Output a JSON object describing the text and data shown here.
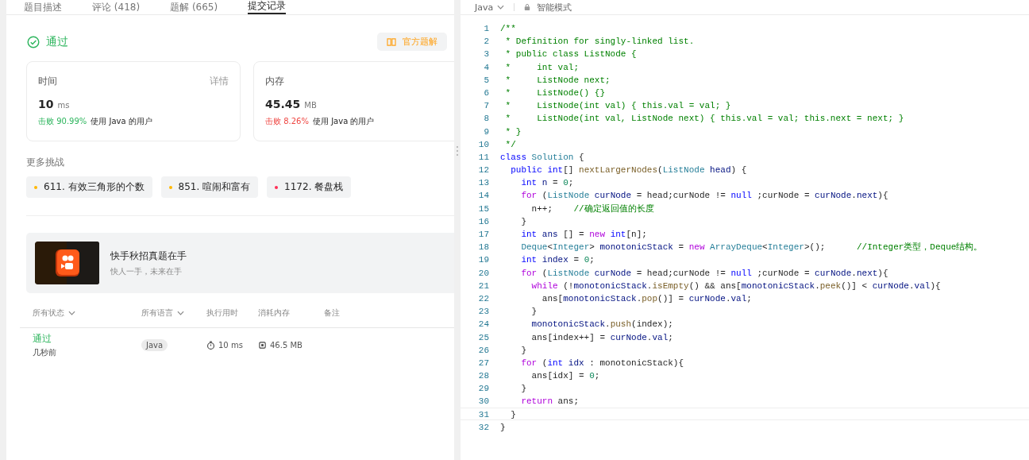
{
  "tabs": [
    {
      "label": "题目描述",
      "selected": false
    },
    {
      "label": "评论 (418)",
      "selected": false
    },
    {
      "label": "题解 (665)",
      "selected": false
    },
    {
      "label": "提交记录",
      "selected": true
    }
  ],
  "result": {
    "status": "通过",
    "solution_button": "官方题解"
  },
  "cards": [
    {
      "title": "时间",
      "detail": "详情",
      "value": "10",
      "unit": "ms",
      "beat": "击败 90.99%",
      "kind": "good",
      "note": "使用 Java 的用户"
    },
    {
      "title": "内存",
      "value": "45.45",
      "unit": "MB",
      "beat": "击败 8.26%",
      "kind": "bad",
      "note": "使用 Java 的用户"
    }
  ],
  "more_challenges": {
    "title": "更多挑战",
    "items": [
      {
        "label": "611. 有效三角形的个数",
        "color": "#ffb800"
      },
      {
        "label": "851. 喧闹和富有",
        "color": "#ffb800"
      },
      {
        "label": "1172. 餐盘栈",
        "color": "#ff2d55"
      }
    ]
  },
  "banner": {
    "title": "快手秋招真题在手",
    "subtitle": "快人一手，未来在手"
  },
  "table": {
    "columns": [
      {
        "label": "所有状态",
        "dropdown": true
      },
      {
        "label": "所有语言",
        "dropdown": true
      },
      {
        "label": "执行用时",
        "dropdown": false
      },
      {
        "label": "消耗内存",
        "dropdown": false
      },
      {
        "label": "备注",
        "dropdown": false
      }
    ],
    "rows": [
      {
        "status": "通过",
        "time_ago": "几秒前",
        "language": "Java",
        "runtime": "10 ms",
        "memory": "46.5 MB"
      }
    ]
  },
  "editor": {
    "language": "Java",
    "mode": "智能模式",
    "lines": [
      {
        "number": "1",
        "active": false,
        "tokens": [
          {
            "kind": "comment",
            "text": "/**"
          }
        ]
      },
      {
        "number": "2",
        "active": false,
        "tokens": [
          {
            "kind": "comment",
            "text": " * Definition for singly-linked list."
          }
        ]
      },
      {
        "number": "3",
        "active": false,
        "tokens": [
          {
            "kind": "comment",
            "text": " * public class ListNode {"
          }
        ]
      },
      {
        "number": "4",
        "active": false,
        "tokens": [
          {
            "kind": "comment",
            "text": " *     int val;"
          }
        ]
      },
      {
        "number": "5",
        "active": false,
        "tokens": [
          {
            "kind": "comment",
            "text": " *     ListNode next;"
          }
        ]
      },
      {
        "number": "6",
        "active": false,
        "tokens": [
          {
            "kind": "comment",
            "text": " *     ListNode() {}"
          }
        ]
      },
      {
        "number": "7",
        "active": false,
        "tokens": [
          {
            "kind": "comment",
            "text": " *     ListNode(int val) { this.val = val; }"
          }
        ]
      },
      {
        "number": "8",
        "active": false,
        "tokens": [
          {
            "kind": "comment",
            "text": " *     ListNode(int val, ListNode next) { this.val = val; this.next = next; }"
          }
        ]
      },
      {
        "number": "9",
        "active": false,
        "tokens": [
          {
            "kind": "comment",
            "text": " * }"
          }
        ]
      },
      {
        "number": "10",
        "active": false,
        "tokens": [
          {
            "kind": "comment",
            "text": " */"
          }
        ]
      },
      {
        "number": "11",
        "active": false,
        "tokens": [
          {
            "kind": "builtin",
            "text": "class "
          },
          {
            "kind": "type",
            "text": "Solution"
          },
          {
            "kind": "plain",
            "text": " {"
          }
        ]
      },
      {
        "number": "12",
        "active": false,
        "tokens": [
          {
            "kind": "builtin",
            "text": "  public int"
          },
          {
            "kind": "plain",
            "text": "[] "
          },
          {
            "kind": "function",
            "text": "nextLargerNodes"
          },
          {
            "kind": "plain",
            "text": "("
          },
          {
            "kind": "type",
            "text": "ListNode "
          },
          {
            "kind": "variable",
            "text": "head"
          },
          {
            "kind": "plain",
            "text": ") {"
          }
        ]
      },
      {
        "number": "13",
        "active": false,
        "tokens": [
          {
            "kind": "builtin",
            "text": "    int "
          },
          {
            "kind": "variable",
            "text": "n"
          },
          {
            "kind": "plain",
            "text": " = "
          },
          {
            "kind": "number",
            "text": "0"
          },
          {
            "kind": "plain",
            "text": ";"
          }
        ]
      },
      {
        "number": "14",
        "active": false,
        "tokens": [
          {
            "kind": "keyword",
            "text": "    for"
          },
          {
            "kind": "plain",
            "text": " ("
          },
          {
            "kind": "type",
            "text": "ListNode "
          },
          {
            "kind": "variable",
            "text": "curNode"
          },
          {
            "kind": "plain",
            "text": " = head;curNode != "
          },
          {
            "kind": "builtin",
            "text": "null"
          },
          {
            "kind": "plain",
            "text": " ;curNode = "
          },
          {
            "kind": "variable",
            "text": "curNode"
          },
          {
            "kind": "plain",
            "text": "."
          },
          {
            "kind": "variable",
            "text": "next"
          },
          {
            "kind": "plain",
            "text": "){"
          }
        ]
      },
      {
        "number": "15",
        "active": false,
        "tokens": [
          {
            "kind": "plain",
            "text": "      n++;    "
          },
          {
            "kind": "comment",
            "text": "//确定返回值的长度"
          }
        ]
      },
      {
        "number": "16",
        "active": false,
        "tokens": [
          {
            "kind": "plain",
            "text": "    }"
          }
        ]
      },
      {
        "number": "17",
        "active": false,
        "tokens": [
          {
            "kind": "builtin",
            "text": "    int "
          },
          {
            "kind": "variable",
            "text": "ans"
          },
          {
            "kind": "plain",
            "text": " [] = "
          },
          {
            "kind": "keyword",
            "text": "new "
          },
          {
            "kind": "builtin",
            "text": "int"
          },
          {
            "kind": "plain",
            "text": "[n];"
          }
        ]
      },
      {
        "number": "18",
        "active": false,
        "tokens": [
          {
            "kind": "type",
            "text": "    Deque"
          },
          {
            "kind": "plain",
            "text": "<"
          },
          {
            "kind": "type",
            "text": "Integer"
          },
          {
            "kind": "plain",
            "text": "> "
          },
          {
            "kind": "variable",
            "text": "monotonicStack"
          },
          {
            "kind": "plain",
            "text": " = "
          },
          {
            "kind": "keyword",
            "text": "new "
          },
          {
            "kind": "type",
            "text": "ArrayDeque"
          },
          {
            "kind": "plain",
            "text": "<"
          },
          {
            "kind": "type",
            "text": "Integer"
          },
          {
            "kind": "plain",
            "text": ">();      "
          },
          {
            "kind": "comment",
            "text": "//Integer类型，Deque结构。"
          }
        ]
      },
      {
        "number": "19",
        "active": false,
        "tokens": [
          {
            "kind": "builtin",
            "text": "    int "
          },
          {
            "kind": "variable",
            "text": "index"
          },
          {
            "kind": "plain",
            "text": " = "
          },
          {
            "kind": "number",
            "text": "0"
          },
          {
            "kind": "plain",
            "text": ";"
          }
        ]
      },
      {
        "number": "20",
        "active": false,
        "tokens": [
          {
            "kind": "keyword",
            "text": "    for"
          },
          {
            "kind": "plain",
            "text": " ("
          },
          {
            "kind": "type",
            "text": "ListNode "
          },
          {
            "kind": "variable",
            "text": "curNode"
          },
          {
            "kind": "plain",
            "text": " = head;curNode != "
          },
          {
            "kind": "builtin",
            "text": "null"
          },
          {
            "kind": "plain",
            "text": " ;curNode = "
          },
          {
            "kind": "variable",
            "text": "curNode"
          },
          {
            "kind": "plain",
            "text": "."
          },
          {
            "kind": "variable",
            "text": "next"
          },
          {
            "kind": "plain",
            "text": "){"
          }
        ]
      },
      {
        "number": "21",
        "active": false,
        "tokens": [
          {
            "kind": "keyword",
            "text": "      while"
          },
          {
            "kind": "plain",
            "text": " (!"
          },
          {
            "kind": "variable",
            "text": "monotonicStack"
          },
          {
            "kind": "plain",
            "text": "."
          },
          {
            "kind": "function",
            "text": "isEmpty"
          },
          {
            "kind": "plain",
            "text": "() && ans["
          },
          {
            "kind": "variable",
            "text": "monotonicStack"
          },
          {
            "kind": "plain",
            "text": "."
          },
          {
            "kind": "function",
            "text": "peek"
          },
          {
            "kind": "plain",
            "text": "()] < "
          },
          {
            "kind": "variable",
            "text": "curNode"
          },
          {
            "kind": "plain",
            "text": "."
          },
          {
            "kind": "variable",
            "text": "val"
          },
          {
            "kind": "plain",
            "text": "){"
          }
        ]
      },
      {
        "number": "22",
        "active": false,
        "tokens": [
          {
            "kind": "plain",
            "text": "        ans["
          },
          {
            "kind": "variable",
            "text": "monotonicStack"
          },
          {
            "kind": "plain",
            "text": "."
          },
          {
            "kind": "function",
            "text": "pop"
          },
          {
            "kind": "plain",
            "text": "()] = "
          },
          {
            "kind": "variable",
            "text": "curNode"
          },
          {
            "kind": "plain",
            "text": "."
          },
          {
            "kind": "variable",
            "text": "val"
          },
          {
            "kind": "plain",
            "text": ";"
          }
        ]
      },
      {
        "number": "23",
        "active": false,
        "tokens": [
          {
            "kind": "plain",
            "text": "      }"
          }
        ]
      },
      {
        "number": "24",
        "active": false,
        "tokens": [
          {
            "kind": "variable",
            "text": "      monotonicStack"
          },
          {
            "kind": "plain",
            "text": "."
          },
          {
            "kind": "function",
            "text": "push"
          },
          {
            "kind": "plain",
            "text": "(index);"
          }
        ]
      },
      {
        "number": "25",
        "active": false,
        "tokens": [
          {
            "kind": "plain",
            "text": "      ans[index++] = "
          },
          {
            "kind": "variable",
            "text": "curNode"
          },
          {
            "kind": "plain",
            "text": "."
          },
          {
            "kind": "variable",
            "text": "val"
          },
          {
            "kind": "plain",
            "text": ";"
          }
        ]
      },
      {
        "number": "26",
        "active": false,
        "tokens": [
          {
            "kind": "plain",
            "text": "    }"
          }
        ]
      },
      {
        "number": "27",
        "active": false,
        "tokens": [
          {
            "kind": "keyword",
            "text": "    for"
          },
          {
            "kind": "plain",
            "text": " ("
          },
          {
            "kind": "builtin",
            "text": "int "
          },
          {
            "kind": "variable",
            "text": "idx"
          },
          {
            "kind": "plain",
            "text": " : monotonicStack){"
          }
        ]
      },
      {
        "number": "28",
        "active": false,
        "tokens": [
          {
            "kind": "plain",
            "text": "      ans[idx] = "
          },
          {
            "kind": "number",
            "text": "0"
          },
          {
            "kind": "plain",
            "text": ";"
          }
        ]
      },
      {
        "number": "29",
        "active": false,
        "tokens": [
          {
            "kind": "plain",
            "text": "    }"
          }
        ]
      },
      {
        "number": "30",
        "active": false,
        "tokens": [
          {
            "kind": "keyword",
            "text": "    return"
          },
          {
            "kind": "plain",
            "text": " ans;"
          }
        ]
      },
      {
        "number": "31",
        "active": true,
        "tokens": [
          {
            "kind": "plain",
            "text": "  }"
          }
        ]
      },
      {
        "number": "32",
        "active": false,
        "tokens": [
          {
            "kind": "plain",
            "text": "}"
          }
        ]
      }
    ]
  }
}
